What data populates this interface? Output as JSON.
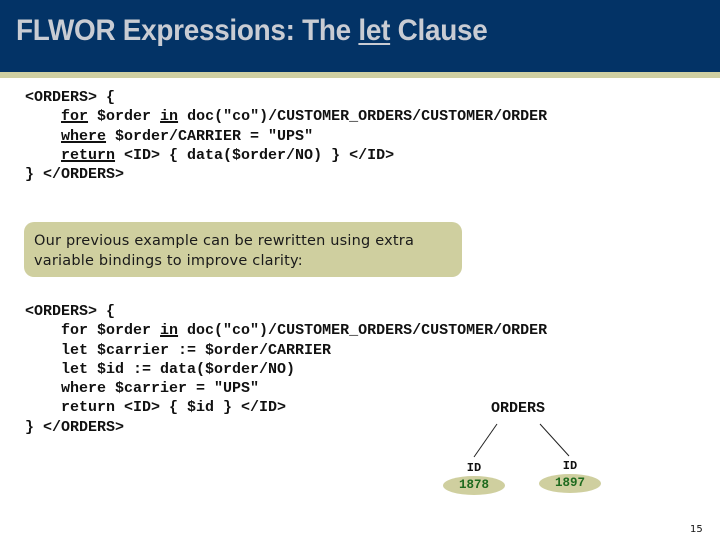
{
  "slide": {
    "title_parts": {
      "before": "FLWOR Expressions: The ",
      "underlined": "let",
      "after": " Clause"
    },
    "page_number": "15",
    "colors": {
      "header_bg": "#033366",
      "header_stripe": "#cfcfa2",
      "title_text": "#c9ccd3",
      "callout_bg": "#cfcf9f",
      "leaf_value_text": "#1f6b1f"
    }
  },
  "code_block_1": {
    "lines": [
      {
        "segments": [
          {
            "text": "<ORDERS> {",
            "u": false
          }
        ]
      },
      {
        "segments": [
          {
            "text": "    ",
            "u": false
          },
          {
            "text": "for",
            "u": true
          },
          {
            "text": " $order ",
            "u": false
          },
          {
            "text": "in",
            "u": true
          },
          {
            "text": " doc(\"co\")/CUSTOMER_ORDERS/CUSTOMER/ORDER",
            "u": false
          }
        ]
      },
      {
        "segments": [
          {
            "text": "    ",
            "u": false
          },
          {
            "text": "where",
            "u": true
          },
          {
            "text": " $order/CARRIER = \"UPS\"",
            "u": false
          }
        ]
      },
      {
        "segments": [
          {
            "text": "    ",
            "u": false
          },
          {
            "text": "return",
            "u": true
          },
          {
            "text": " <ID> { data($order/NO) } </ID>",
            "u": false
          }
        ]
      },
      {
        "segments": [
          {
            "text": "} </ORDERS>",
            "u": false
          }
        ]
      }
    ]
  },
  "callout": {
    "line1": "Our previous example can be rewritten using extra",
    "line2": "variable bindings to improve clarity:"
  },
  "code_block_2": {
    "lines": [
      {
        "segments": [
          {
            "text": "<ORDERS> {",
            "u": false
          }
        ]
      },
      {
        "segments": [
          {
            "text": "    for $order ",
            "u": false
          },
          {
            "text": "in",
            "u": true
          },
          {
            "text": " doc(\"co\")/CUSTOMER_ORDERS/CUSTOMER/ORDER",
            "u": false
          }
        ]
      },
      {
        "segments": [
          {
            "text": "    let $carrier := $order/CARRIER",
            "u": false
          }
        ]
      },
      {
        "segments": [
          {
            "text": "    let $id := data($order/NO)",
            "u": false
          }
        ]
      },
      {
        "segments": [
          {
            "text": "    where $carrier = \"UPS\"",
            "u": false
          }
        ]
      },
      {
        "segments": [
          {
            "text": "    return <ID> { $id } </ID>",
            "u": false
          }
        ]
      },
      {
        "segments": [
          {
            "text": "} </ORDERS>",
            "u": false
          }
        ]
      }
    ]
  },
  "result_tree": {
    "root": "ORDERS",
    "children": [
      {
        "label": "ID",
        "value": "1878"
      },
      {
        "label": "ID",
        "value": "1897"
      }
    ]
  }
}
